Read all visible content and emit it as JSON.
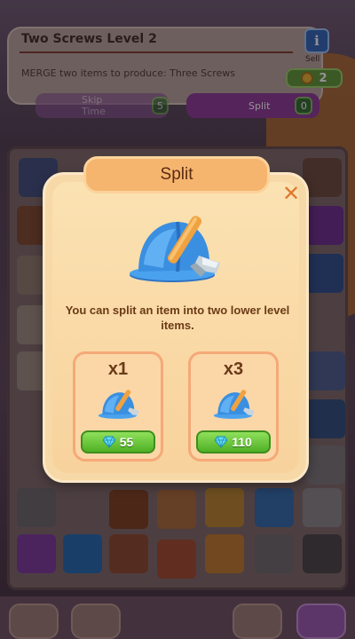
{
  "quest": {
    "title": "Two Screws Level 2",
    "description": "MERGE two items to produce:  Three Screws",
    "info_label": "i",
    "sell_label": "Sell",
    "sell_value": "2"
  },
  "actions": {
    "skip_label": "Skip Time",
    "skip_count": "5",
    "split_label": "Split",
    "split_count": "0"
  },
  "dialog": {
    "title": "Split",
    "close_label": "✕",
    "item_icon": "hard-hat-with-hammer-icon",
    "description": "You can split an item into two lower level items.",
    "options": [
      {
        "quantity": "x1",
        "price": "55",
        "currency_icon": "diamond-icon"
      },
      {
        "quantity": "x3",
        "price": "110",
        "currency_icon": "diamond-icon"
      }
    ]
  },
  "colors": {
    "dialog_bg": "#f7d9a7",
    "title_tab": "#f6b56f",
    "price_button": "#5cbf2a",
    "helmet_blue": "#3a8fe0",
    "text_brown": "#6b3a16"
  }
}
